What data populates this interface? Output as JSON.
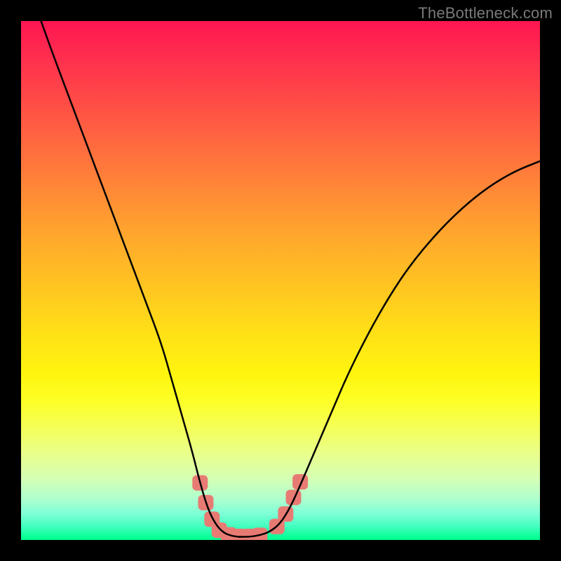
{
  "watermark": "TheBottleneck.com",
  "chart_data": {
    "type": "line",
    "title": "",
    "xlabel": "",
    "ylabel": "",
    "xlim": [
      0,
      100
    ],
    "ylim": [
      0,
      100
    ],
    "grid": false,
    "legend": false,
    "background": "rainbow-vertical-gradient",
    "series": [
      {
        "name": "left-arm",
        "stroke": "#000000",
        "stroke_width": 2.5,
        "points": [
          {
            "x": 3.5,
            "y": 101
          },
          {
            "x": 6,
            "y": 94
          },
          {
            "x": 9,
            "y": 86
          },
          {
            "x": 12,
            "y": 78
          },
          {
            "x": 15,
            "y": 70
          },
          {
            "x": 18,
            "y": 62
          },
          {
            "x": 21,
            "y": 54
          },
          {
            "x": 24,
            "y": 46
          },
          {
            "x": 27,
            "y": 38
          },
          {
            "x": 29,
            "y": 31
          },
          {
            "x": 31,
            "y": 24
          },
          {
            "x": 33,
            "y": 17
          },
          {
            "x": 34.5,
            "y": 11
          },
          {
            "x": 36,
            "y": 6
          },
          {
            "x": 37.5,
            "y": 3
          },
          {
            "x": 39,
            "y": 1.4
          },
          {
            "x": 40.5,
            "y": 0.8
          },
          {
            "x": 42,
            "y": 0.6
          }
        ]
      },
      {
        "name": "right-arm",
        "stroke": "#000000",
        "stroke_width": 2.5,
        "points": [
          {
            "x": 42,
            "y": 0.6
          },
          {
            "x": 44,
            "y": 0.6
          },
          {
            "x": 46,
            "y": 0.9
          },
          {
            "x": 48,
            "y": 1.6
          },
          {
            "x": 50,
            "y": 3.2
          },
          {
            "x": 52,
            "y": 6.5
          },
          {
            "x": 54,
            "y": 11
          },
          {
            "x": 57,
            "y": 18
          },
          {
            "x": 60,
            "y": 25
          },
          {
            "x": 63,
            "y": 32
          },
          {
            "x": 67,
            "y": 40
          },
          {
            "x": 71,
            "y": 47
          },
          {
            "x": 75,
            "y": 53
          },
          {
            "x": 80,
            "y": 59
          },
          {
            "x": 85,
            "y": 64
          },
          {
            "x": 90,
            "y": 68
          },
          {
            "x": 95,
            "y": 71
          },
          {
            "x": 100,
            "y": 73
          }
        ]
      }
    ],
    "markers": [
      {
        "name": "bottom-markers",
        "shape": "rounded-square",
        "fill": "#e77b74",
        "size": 22,
        "points": [
          {
            "x": 34.5,
            "y": 11
          },
          {
            "x": 35.6,
            "y": 7.2
          },
          {
            "x": 36.8,
            "y": 4.0
          },
          {
            "x": 38.2,
            "y": 1.9
          },
          {
            "x": 40.0,
            "y": 1.0
          },
          {
            "x": 42.0,
            "y": 0.7
          },
          {
            "x": 44.0,
            "y": 0.7
          },
          {
            "x": 46.0,
            "y": 0.9
          },
          {
            "x": 49.3,
            "y": 2.6
          },
          {
            "x": 51.0,
            "y": 5.0
          },
          {
            "x": 52.5,
            "y": 8.2
          },
          {
            "x": 53.8,
            "y": 11.2
          }
        ]
      }
    ]
  }
}
